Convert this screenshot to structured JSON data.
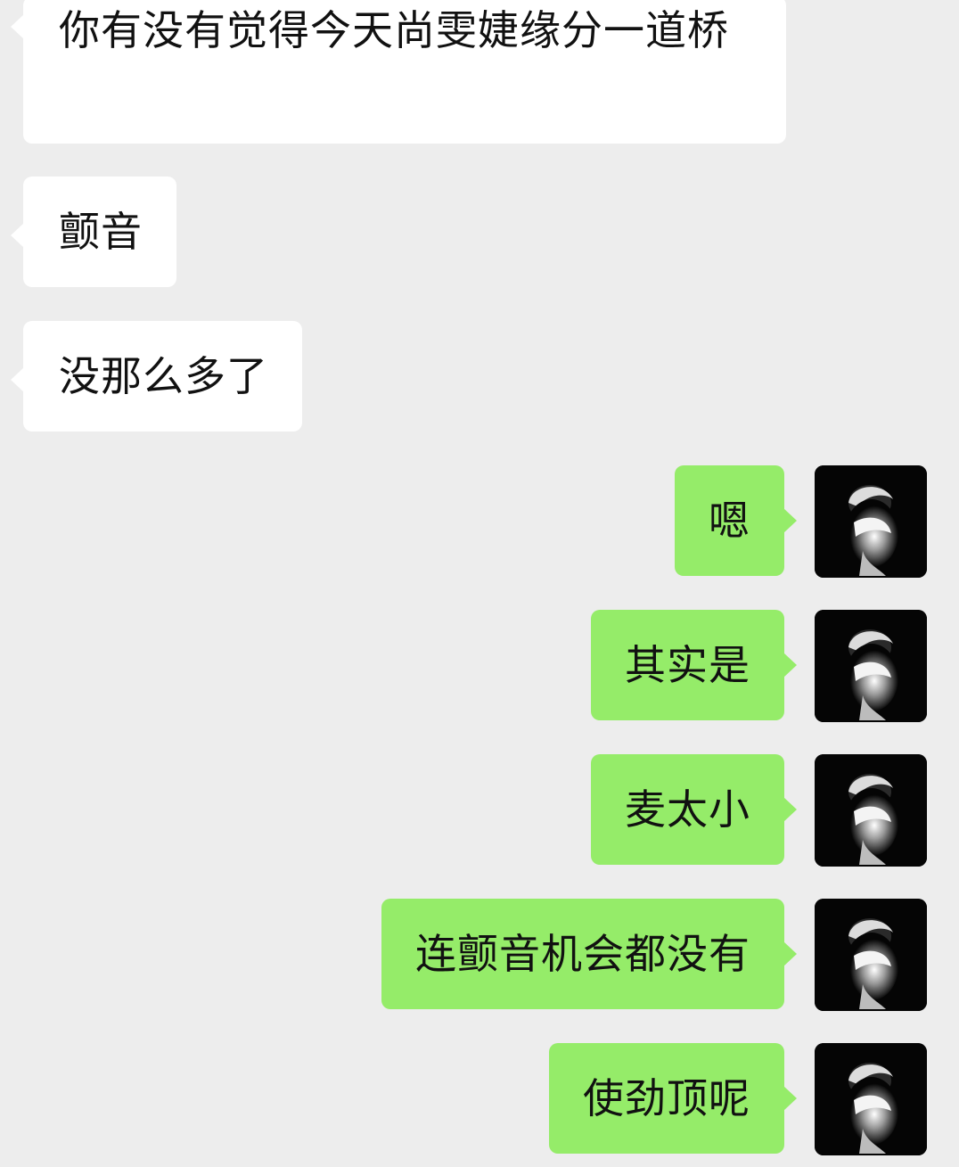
{
  "chat": {
    "incoming": [
      {
        "text": "你有没有觉得今天尚雯婕缘分一道桥"
      },
      {
        "text": "颤音"
      },
      {
        "text": "没那么多了"
      }
    ],
    "outgoing": [
      {
        "text": "嗯"
      },
      {
        "text": "其实是"
      },
      {
        "text": "麦太小"
      },
      {
        "text": "连颤音机会都没有"
      },
      {
        "text": "使劲顶呢"
      }
    ],
    "colors": {
      "background": "#ededed",
      "incoming_bubble": "#ffffff",
      "outgoing_bubble": "#95ec69",
      "text": "#111111"
    },
    "avatar": {
      "icon": "portrait-avatar-icon"
    }
  }
}
